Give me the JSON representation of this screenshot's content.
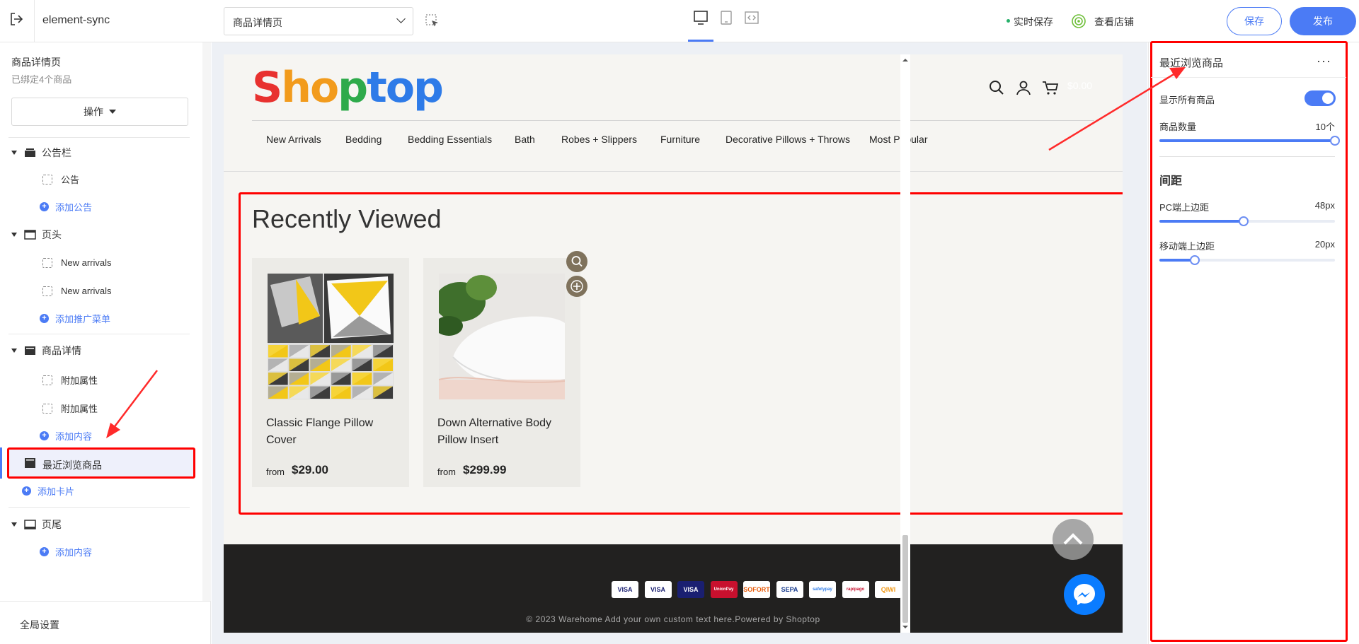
{
  "topbar": {
    "app_name": "element-sync",
    "page_select": "商品详情页",
    "autosave": "实时保存",
    "view_store": "查看店铺",
    "save": "保存",
    "publish": "发布"
  },
  "sidebar": {
    "title": "商品详情页",
    "subtitle": "已绑定4个商品",
    "ops_button": "操作",
    "groups": [
      {
        "label": "公告栏",
        "items": [
          "公告"
        ],
        "add": "添加公告"
      },
      {
        "label": "页头",
        "items": [
          "New arrivals",
          "New arrivals"
        ],
        "add": "添加推广菜单"
      },
      {
        "label": "商品详情",
        "items": [
          "附加属性",
          "附加属性"
        ],
        "add": "添加内容"
      }
    ],
    "selected": "最近浏览商品",
    "add_card": "添加卡片",
    "footer_group": {
      "label": "页尾",
      "add": "添加内容"
    },
    "global_settings": "全局设置"
  },
  "preview": {
    "logo": [
      "S",
      "h",
      "o",
      "p",
      "t",
      "o",
      "p"
    ],
    "logo_colors": [
      "#e8312f",
      "#f29b1c",
      "#f29b1c",
      "#2eaa4b",
      "#2e7be8",
      "#2e7be8",
      "#2e7be8"
    ],
    "cart_amount": "$0.00",
    "nav": [
      "New Arrivals",
      "Bedding",
      "Bedding Essentials",
      "Bath",
      "Robes + Slippers",
      "Furniture",
      "Decorative Pillows + Throws",
      "Most Popular"
    ],
    "section_title": "Recently Viewed",
    "products": [
      {
        "name": "Classic Flange Pillow Cover",
        "from": "from",
        "price": "$29.00"
      },
      {
        "name": "Down Alternative Body Pillow Insert",
        "from": "from",
        "price": "$299.99"
      }
    ],
    "payments": [
      "VISA",
      "VISA",
      "VISA",
      "UnionPay",
      "SOFORT",
      "SEPA",
      "safetypay",
      "rapipago",
      "QIWI"
    ],
    "copyright": "© 2023 Warehome Add your own custom text here.Powered by Shoptop"
  },
  "right_panel": {
    "title": "最近浏览商品",
    "more": "···",
    "show_all_label": "显示所有商品",
    "show_all_on": true,
    "count_label": "商品数量",
    "count_value": "10个",
    "count_fraction": 1.0,
    "spacing_section": "间距",
    "pc_top_label": "PC端上边距",
    "pc_top_value": "48px",
    "pc_top_fraction": 0.48,
    "mobile_top_label": "移动端上边距",
    "mobile_top_value": "20px",
    "mobile_top_fraction": 0.2
  },
  "colors": {
    "accent": "#4b7bf5",
    "highlight": "#ff0000"
  }
}
